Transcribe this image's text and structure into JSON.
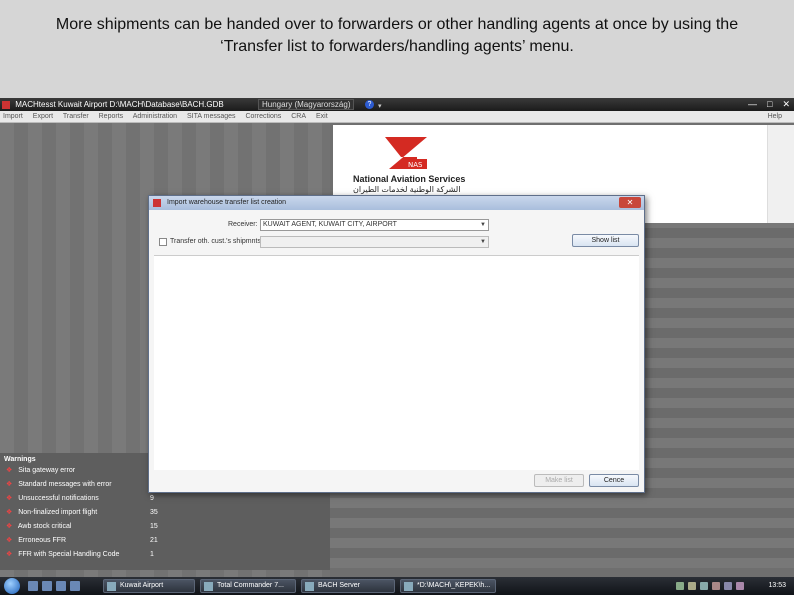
{
  "caption": {
    "line1": "More shipments can be handed over to forwarders or other handling agents at once by using the",
    "line2": "‘Transfer list to forwarders/handling agents’ menu."
  },
  "titlebar": {
    "title": "MACHtesst   Kuwait Airport   D:\\MACH\\Database\\BACH.GDB",
    "language": "Hungary (Magyarország)",
    "help_badge": "?",
    "minimize": "—",
    "maximize": "□",
    "close": "✕"
  },
  "menu": {
    "items": [
      "Import",
      "Export",
      "Transfer",
      "Reports",
      "Administration",
      "SITA messages",
      "Corrections",
      "CRA",
      "Exit"
    ],
    "help": "Help"
  },
  "logo": {
    "name": "National Aviation Services",
    "arabic": "الشركة الوطنية لخدمات الطيران"
  },
  "warnings": {
    "header": "Warnings",
    "rows": [
      {
        "label": "Sita gateway error",
        "count": ""
      },
      {
        "label": "Standard messages with error",
        "count": "7"
      },
      {
        "label": "Unsuccessful notifications",
        "count": "9"
      },
      {
        "label": "Non-finalized import flight",
        "count": "35"
      },
      {
        "label": "Awb stock critical",
        "count": "15"
      },
      {
        "label": "Erroneous FFR",
        "count": "21"
      },
      {
        "label": "FFR with Special Handling Code",
        "count": "1"
      }
    ]
  },
  "dialog": {
    "title": "Import warehouse transfer list creation",
    "close": "✕",
    "receiver_label": "Receiver:",
    "receiver_value": "KUWAIT AGENT, KUWAIT CITY, AIRPORT",
    "transfer_label": "Transfer oth. cust.'s shipmnts:",
    "transfer_value": "",
    "show_list": "Show list",
    "make_list": "Make list",
    "cancel": "Cence"
  },
  "taskbar": {
    "tasks": [
      "Kuwait Airport",
      "Total Commander 7...",
      "BACH Server",
      "*D:\\MACH\\_KEPEK\\h..."
    ],
    "clock": "13:53"
  }
}
